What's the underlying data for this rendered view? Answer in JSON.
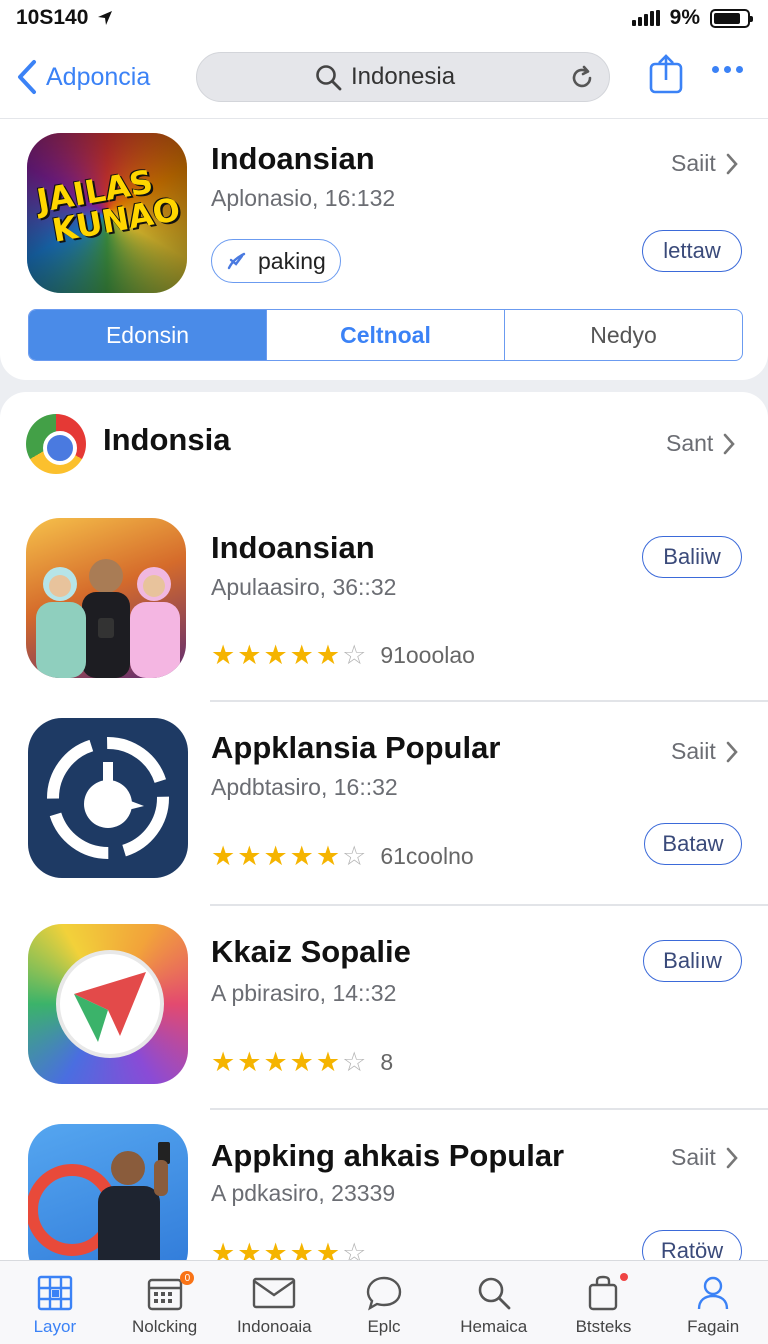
{
  "status_bar": {
    "time": "10S140",
    "battery": "9%"
  },
  "header": {
    "back_label": "Adponcia",
    "search_query": "Indonesia"
  },
  "featured": {
    "icon_text_line1": "JAILAS",
    "icon_text_line2": "KUNAO",
    "title": "Indoansian",
    "subtitle": "Aplonasio,  16:132",
    "see_link": "Saiit",
    "tag_label": "paking",
    "action_label": "lettaw",
    "segments": [
      "Edonsin",
      "Celtnoal",
      "Nedyo"
    ]
  },
  "section": {
    "title": "Indonsia",
    "see_link": "Sant"
  },
  "apps": [
    {
      "title": "Indoansian",
      "subtitle": "Apulaasiro,  36::32",
      "rating": 4.5,
      "count": "91ooolao",
      "action": "Baliiw",
      "see_link": ""
    },
    {
      "title": "Appklansia Popular",
      "subtitle": "Apdbtasiro,  16::32",
      "rating": 4.5,
      "count": "61coolno",
      "action": "Bataw",
      "see_link": "Saiit"
    },
    {
      "title": "Kkaiz Sopalie",
      "subtitle": "A pbirasiro,  14::32",
      "rating": 4.5,
      "count": "8",
      "action": "Baliıw",
      "see_link": ""
    },
    {
      "title": "Appking ahkais Popular",
      "subtitle": "A pdkasiro,  23339",
      "rating": 4.5,
      "count": "",
      "action": "Ratöw",
      "see_link": "Saiit"
    }
  ],
  "tabs": [
    {
      "label": "Layor",
      "icon": "grid-icon",
      "active": true
    },
    {
      "label": "Nolcking",
      "icon": "calendar-icon",
      "badge": "0"
    },
    {
      "label": "Indonoaia",
      "icon": "mail-icon"
    },
    {
      "label": "Eplc",
      "icon": "chat-icon"
    },
    {
      "label": "Hemaica",
      "icon": "search-icon"
    },
    {
      "label": "Btsteks",
      "icon": "bag-icon"
    },
    {
      "label": "Fagain",
      "icon": "person-icon"
    }
  ],
  "colors": {
    "accent": "#3b82f6",
    "star": "#f5b400",
    "segment_active": "#4a8be8"
  }
}
